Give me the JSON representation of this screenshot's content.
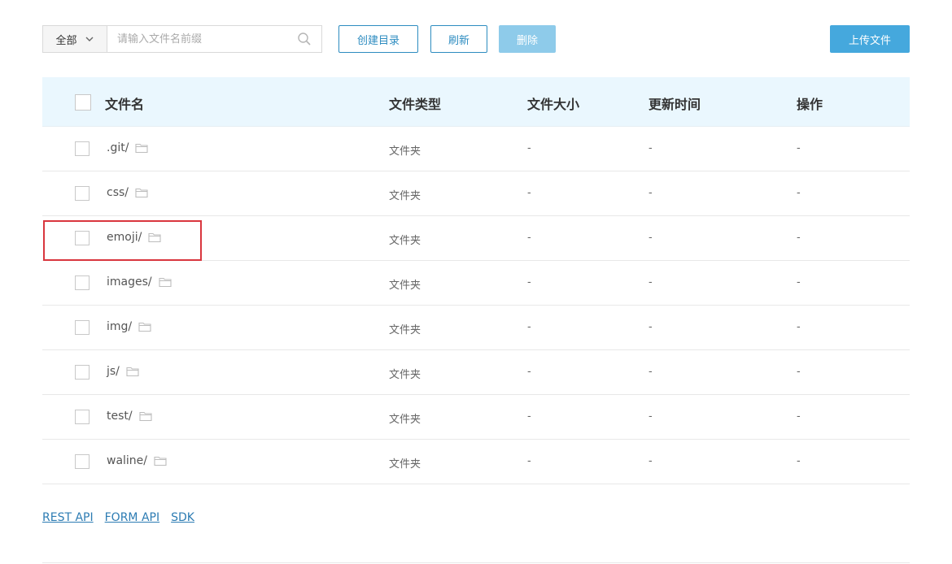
{
  "toolbar": {
    "filter_select": "全部",
    "search_placeholder": "请输入文件名前缀",
    "search_value": "",
    "create_dir_label": "创建目录",
    "refresh_label": "刷新",
    "delete_label": "删除",
    "upload_label": "上传文件"
  },
  "table": {
    "headers": {
      "name": "文件名",
      "type": "文件类型",
      "size": "文件大小",
      "updated": "更新时间",
      "actions": "操作"
    },
    "rows": [
      {
        "name": ".git/",
        "type": "文件夹",
        "size": "-",
        "updated": "-",
        "actions": "-"
      },
      {
        "name": "css/",
        "type": "文件夹",
        "size": "-",
        "updated": "-",
        "actions": "-"
      },
      {
        "name": "emoji/",
        "type": "文件夹",
        "size": "-",
        "updated": "-",
        "actions": "-"
      },
      {
        "name": "images/",
        "type": "文件夹",
        "size": "-",
        "updated": "-",
        "actions": "-"
      },
      {
        "name": "img/",
        "type": "文件夹",
        "size": "-",
        "updated": "-",
        "actions": "-"
      },
      {
        "name": "js/",
        "type": "文件夹",
        "size": "-",
        "updated": "-",
        "actions": "-"
      },
      {
        "name": "test/",
        "type": "文件夹",
        "size": "-",
        "updated": "-",
        "actions": "-"
      },
      {
        "name": "waline/",
        "type": "文件夹",
        "size": "-",
        "updated": "-",
        "actions": "-"
      }
    ]
  },
  "footer": {
    "links": [
      "REST API",
      "FORM API",
      "SDK"
    ]
  },
  "icons": {
    "dropdown": "chevron-down-icon",
    "search": "search-icon",
    "folder": "folder-icon"
  },
  "colors": {
    "accent": "#2d8cc0",
    "primary_button": "#45a8dd",
    "disabled_button": "#8ecbea",
    "header_bg": "#eaf7fe",
    "highlight_border": "#d9363e"
  }
}
